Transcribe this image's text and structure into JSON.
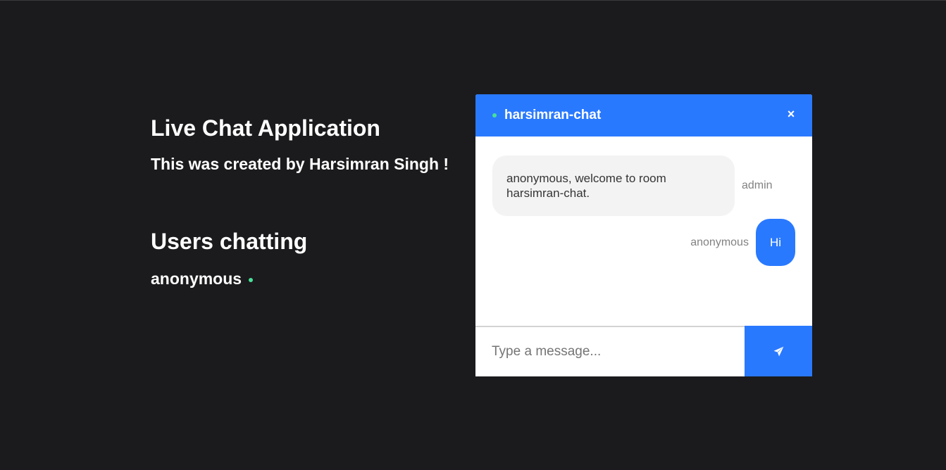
{
  "info": {
    "title": "Live Chat Application",
    "credit": "This was created by Harsimran Singh !",
    "users_heading": "Users chatting",
    "users": [
      {
        "name": "anonymous",
        "status_icon": "online-dot-icon"
      }
    ]
  },
  "chat": {
    "room_name": "harsimran-chat",
    "close_label": "×",
    "messages": [
      {
        "text": "anonymous, welcome to room harsimran-chat.",
        "sender": "admin"
      },
      {
        "text": "Hi",
        "sender": "anonymous"
      }
    ],
    "input": {
      "placeholder": "Type a message...",
      "value": ""
    },
    "send_icon": "paper-plane-icon"
  },
  "colors": {
    "background": "#1b1b1d",
    "accent": "#2979ff",
    "online": "#47e09a",
    "bubble_gray": "#f3f3f3"
  }
}
